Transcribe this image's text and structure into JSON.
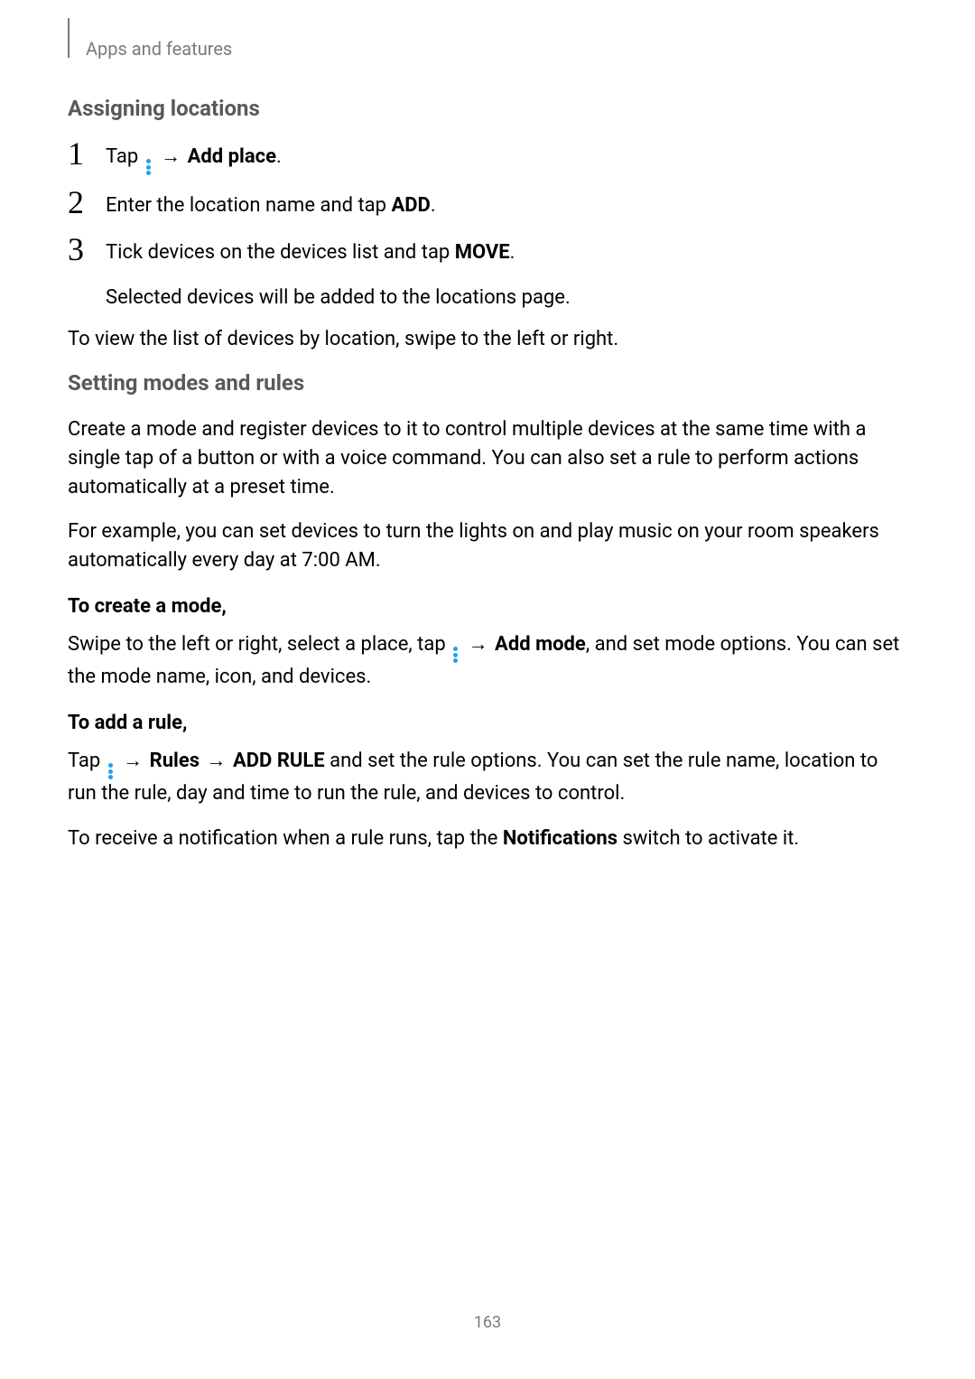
{
  "header": {
    "breadcrumb": "Apps and features"
  },
  "section1": {
    "title": "Assigning locations",
    "step1": {
      "num": "1",
      "pre": "Tap ",
      "post": " → ",
      "bold": "Add place",
      "tail": "."
    },
    "step2": {
      "num": "2",
      "pre": "Enter the location name and tap ",
      "bold": "ADD",
      "tail": "."
    },
    "step3": {
      "num": "3",
      "pre": "Tick devices on the devices list and tap ",
      "bold": "MOVE",
      "tail": ".",
      "sub": "Selected devices will be added to the locations page."
    },
    "after": "To view the list of devices by location, swipe to the left or right."
  },
  "section2": {
    "title": "Setting modes and rules",
    "p1": "Create a mode and register devices to it to control multiple devices at the same time with a single tap of a button or with a voice command. You can also set a rule to perform actions automatically at a preset time.",
    "p2": "For example, you can set devices to turn the lights on and play music on your room speakers automatically every day at 7:00 AM."
  },
  "mode": {
    "heading": "To create a mode,",
    "pre": "Swipe to the left or right, select a place, tap ",
    "arrow": " → ",
    "bold": "Add mode",
    "tail": ", and set mode options. You can set the mode name, icon, and devices."
  },
  "rule": {
    "heading": "To add a rule,",
    "pre": "Tap ",
    "arrow1": " → ",
    "bold1": "Rules",
    "arrow2": " → ",
    "bold2": "ADD RULE",
    "tail": " and set the rule options. You can set the rule name, location to run the rule, day and time to run the rule, and devices to control.",
    "p2a": "To receive a notification when a rule runs, tap the ",
    "p2b": "Notifications",
    "p2c": " switch to activate it."
  },
  "page_number": "163"
}
